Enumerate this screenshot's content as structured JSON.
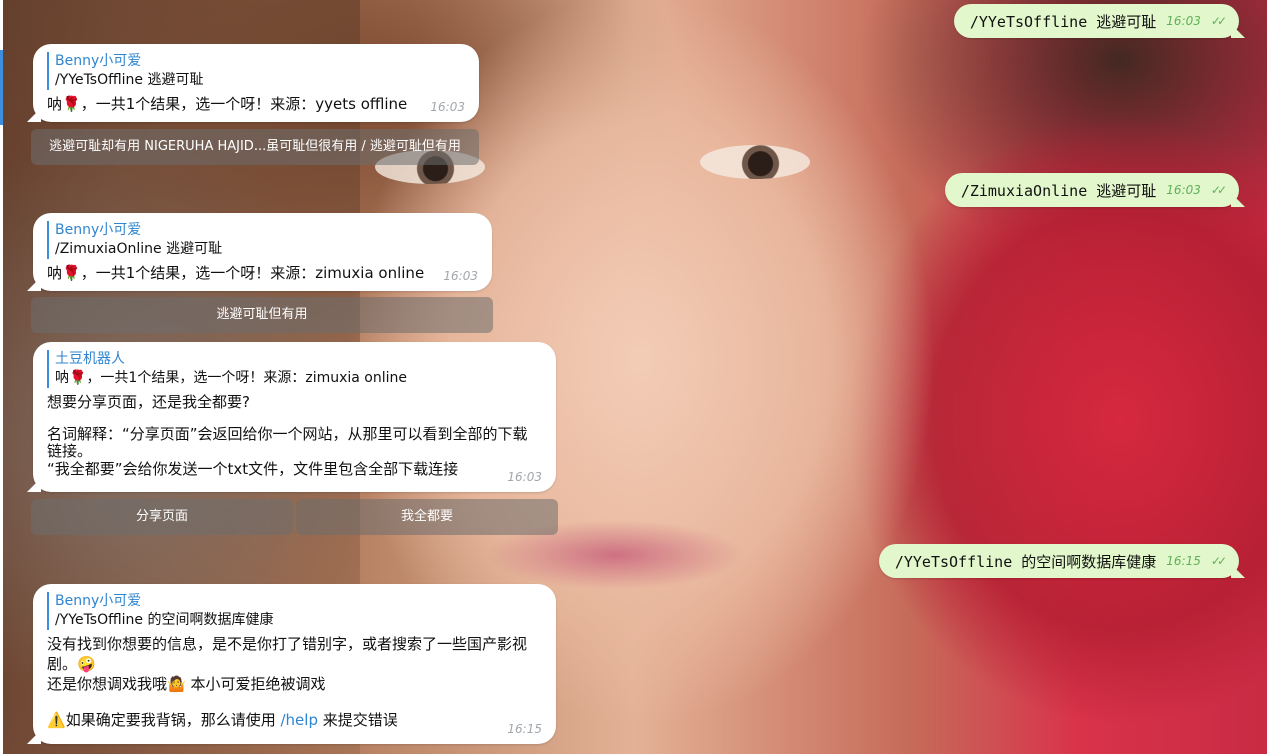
{
  "outgoing": [
    {
      "cmd": "/YYeTsOffline",
      "text": "逃避可耻",
      "time": "16:03"
    },
    {
      "cmd": "/ZimuxiaOnline",
      "text": "逃避可耻",
      "time": "16:03"
    },
    {
      "cmd": "/YYeTsOffline",
      "text": "的空间啊数据库健康",
      "time": "16:15"
    }
  ],
  "incoming": [
    {
      "reply_name": "Benny小可爱",
      "reply_text": "/YYeTsOffline 逃避可耻",
      "msg_prefix": "呐",
      "msg_rest": "，一共1个结果，选一个呀！来源：yyets offline",
      "time": "16:03"
    },
    {
      "reply_name": "Benny小可爱",
      "reply_text": "/ZimuxiaOnline 逃避可耻",
      "msg_prefix": "呐",
      "msg_rest": "，一共1个结果，选一个呀！来源：zimuxia online",
      "time": "16:03"
    },
    {
      "reply_name": "土豆机器人",
      "reply_prefix": "呐",
      "reply_rest": "，一共1个结果，选一个呀！来源：zimuxia online",
      "line1": "想要分享页面，还是我全都要?",
      "line2": "名词解释：“分享页面”会返回给你一个网站，从那里可以看到全部的下载链接。",
      "line3": "“我全都要”会给你发送一个txt文件，文件里包含全部下载连接",
      "time": "16:03"
    },
    {
      "reply_name": "Benny小可爱",
      "reply_text": "/YYeTsOffline 的空间啊数据库健康",
      "line1": "没有找到你想要的信息，是不是你打了错别字，或者搜索了一些国产影视剧。",
      "line2": "还是你想调戏我哦",
      "line2b": " 本小可爱拒绝被调戏",
      "line3_pre": "如果确定要我背锅，那么请使用",
      "line3_link": "/help",
      "line3_post": "来提交错误",
      "time": "16:15"
    }
  ],
  "keyboards": {
    "kb1": "逃避可耻却有用 NIGERUHA HAJID...虽可耻但很有用 / 逃避可耻但有用",
    "kb2": "逃避可耻但有用",
    "kb3_left": "分享页面",
    "kb3_right": "我全都要"
  },
  "icons": {
    "rose": "🌹",
    "dizzy_face": "🤪",
    "shrug": "🤷",
    "warning": "⚠️",
    "double_check": "✓✓"
  }
}
